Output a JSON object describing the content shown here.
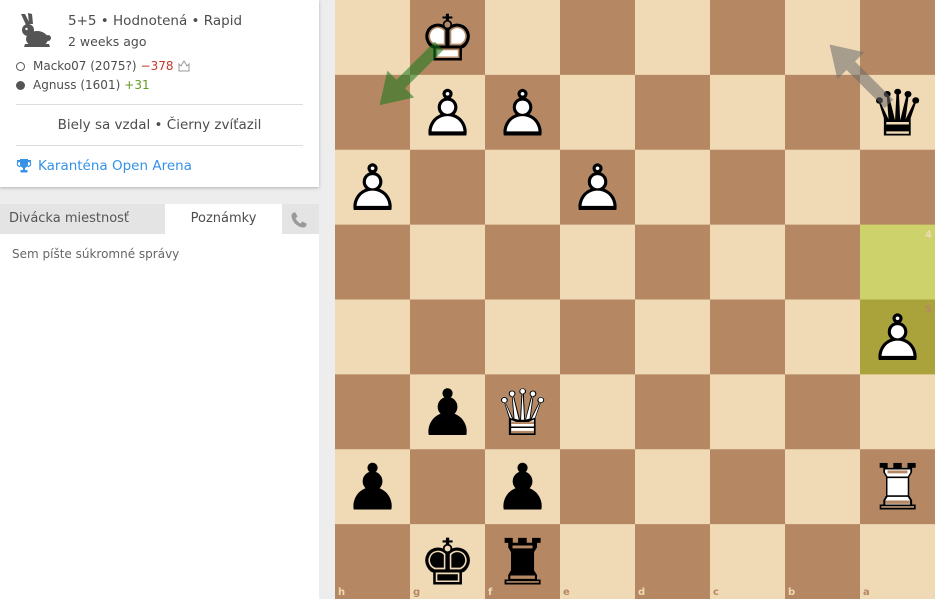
{
  "game": {
    "title": "5+5 • Hodnotená • Rapid",
    "date": "2 weeks ago",
    "icon": "rabbit-icon"
  },
  "players": [
    {
      "color": "white",
      "name": "Macko07 (2075?)",
      "diff": "−378",
      "berserk_icon": "berserk-icon"
    },
    {
      "color": "black",
      "name": "Agnuss (1601)",
      "diff": "+31"
    }
  ],
  "result": "Biely sa vzdal • Čierny zvíťazil",
  "tournament": {
    "name": "Karanténa Open Arena",
    "icon": "trophy-icon"
  },
  "tabs": [
    {
      "label": "Divácka miestnosť",
      "active": false
    },
    {
      "label": "Poznámky",
      "active": true
    }
  ],
  "notes": {
    "placeholder": "Sem píšte súkromné správy"
  },
  "board": {
    "orientation": "black",
    "light_color": "#f0d9b5",
    "dark_color": "#b58863",
    "last_move_colors": {
      "from": "#cdd26a",
      "to": "#aaa23a"
    },
    "files_bottom": [
      "h",
      "g",
      "f",
      "e",
      "d",
      "c",
      "b",
      "a"
    ],
    "ranks_right": [
      "1",
      "2",
      "3",
      "4",
      "5",
      "6",
      "7",
      "8"
    ],
    "last_move": [
      "a4",
      "a5"
    ],
    "pieces": [
      {
        "sq": "g1",
        "piece": "K",
        "color": "white"
      },
      {
        "sq": "g2",
        "piece": "P",
        "color": "white"
      },
      {
        "sq": "f2",
        "piece": "P",
        "color": "white"
      },
      {
        "sq": "a2",
        "piece": "Q",
        "color": "black"
      },
      {
        "sq": "h3",
        "piece": "P",
        "color": "white"
      },
      {
        "sq": "e3",
        "piece": "P",
        "color": "white"
      },
      {
        "sq": "a5",
        "piece": "P",
        "color": "white"
      },
      {
        "sq": "g6",
        "piece": "P",
        "color": "black"
      },
      {
        "sq": "f6",
        "piece": "Q",
        "color": "white"
      },
      {
        "sq": "h7",
        "piece": "P",
        "color": "black"
      },
      {
        "sq": "f7",
        "piece": "P",
        "color": "black"
      },
      {
        "sq": "a7",
        "piece": "R",
        "color": "white"
      },
      {
        "sq": "g8",
        "piece": "K",
        "color": "black"
      },
      {
        "sq": "f8",
        "piece": "R",
        "color": "black"
      }
    ],
    "arrows": [
      {
        "from": "a2",
        "to": "b1",
        "color": "#6c6c6c"
      },
      {
        "from": "g1",
        "to": "h2",
        "color": "#15781b"
      }
    ]
  }
}
